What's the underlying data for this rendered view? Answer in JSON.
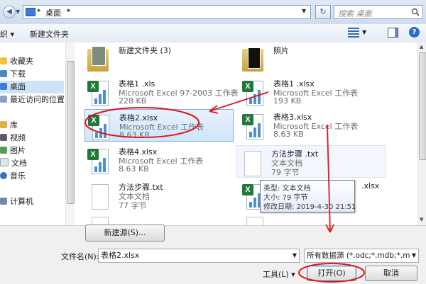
{
  "address": {
    "folder_name": "桌面",
    "search_placeholder": "搜索 桌面"
  },
  "toolbar": {
    "organize_label": "织",
    "new_folder_label": "新建文件夹"
  },
  "nav": {
    "items": [
      {
        "label": "收藏夹"
      },
      {
        "label": "下载"
      },
      {
        "label": "桌面"
      },
      {
        "label": "最近访问的位置"
      },
      {
        "label": "库"
      },
      {
        "label": "视频"
      },
      {
        "label": "图片"
      },
      {
        "label": "文档"
      },
      {
        "label": "音乐"
      },
      {
        "label": "计算机"
      }
    ]
  },
  "files": [
    {
      "name": "新建文件夹 (3)",
      "type": "",
      "size": ""
    },
    {
      "name": "照片",
      "type": "",
      "size": ""
    },
    {
      "name": "表格1 .xls",
      "type": "Microsoft Excel 97-2003 工作表",
      "size": "228 KB"
    },
    {
      "name": "表格1 .xlsx",
      "type": "Microsoft Excel 工作表",
      "size": "193 KB"
    },
    {
      "name": "表格2.xlsx",
      "type": "Microsoft Excel 工作表",
      "size": "8.63 KB"
    },
    {
      "name": "表格3.xlsx",
      "type": "Microsoft Excel 工作表",
      "size": "8.63 KB"
    },
    {
      "name": "表格4.xlsx",
      "type": "Microsoft Excel 工作表",
      "size": "8.63 KB"
    },
    {
      "name": "方法步骤 .txt",
      "type": "文本文档",
      "size": "79 字节"
    },
    {
      "name": "方法步骤.txt",
      "type": "文本文档",
      "size": "77 字节"
    },
    {
      "name": ".xlsx",
      "type": "",
      "size": ""
    }
  ],
  "tooltip": {
    "type_line": "类型: 文本文档",
    "size_line": "大小: 79 字节",
    "date_line": "修改日期: 2019-4-30 21:51"
  },
  "bottom": {
    "new_source_label": "新建源(S)...",
    "filename_label": "文件名(N):",
    "filename_value": "表格2.xlsx",
    "filter_value": "所有数据源 (*.odc;*.mdb;*.md",
    "tools_label": "工具(L)",
    "open_label": "打开(O)",
    "cancel_label": "取消"
  },
  "colors": {
    "annotation_red": "#e0161c",
    "selection_blue": "#cfe5fb",
    "excel_green": "#1f7a3a"
  }
}
